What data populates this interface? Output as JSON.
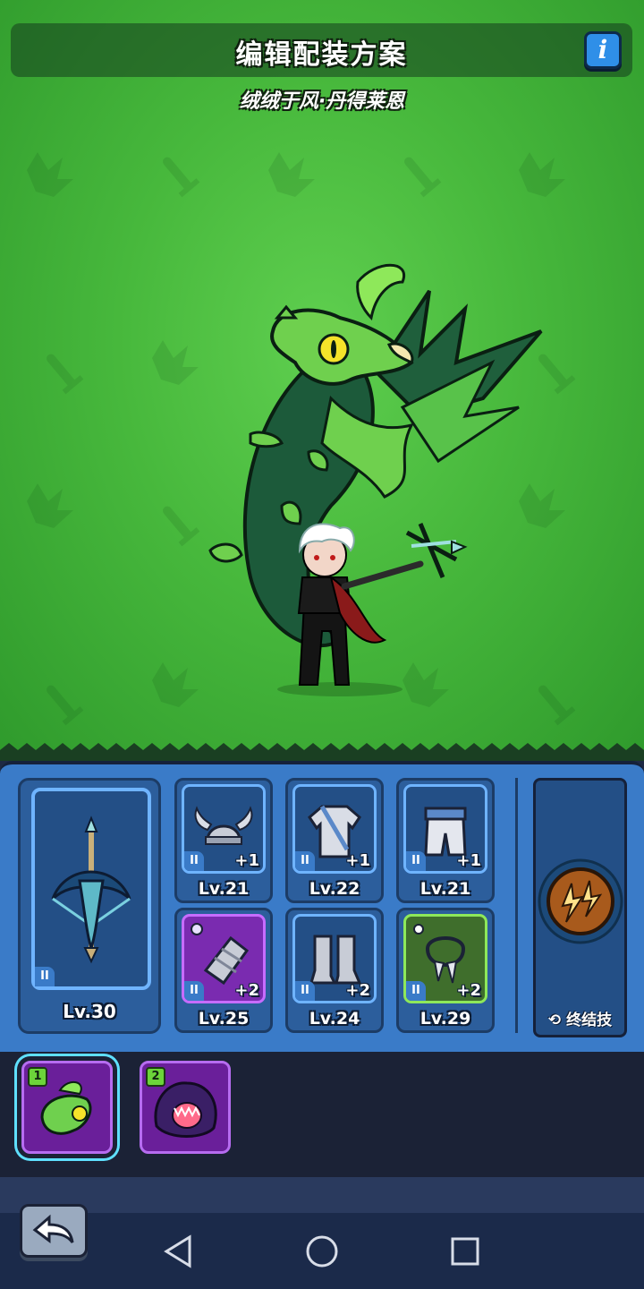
{
  "header": {
    "title": "编辑配装方案",
    "subtitle": "绒绒于风·丹得莱恩",
    "info_label": "i"
  },
  "equipment": {
    "weapon": {
      "level": "Lv.30",
      "tier": "II",
      "icon": "crossbow-icon"
    },
    "slots": [
      {
        "icon": "horned-helmet-icon",
        "tier": "II",
        "bonus": "+1",
        "level": "Lv.21",
        "rarity": "blue"
      },
      {
        "icon": "chest-armor-icon",
        "tier": "II",
        "bonus": "+1",
        "level": "Lv.22",
        "rarity": "blue"
      },
      {
        "icon": "leg-armor-icon",
        "tier": "II",
        "bonus": "+1",
        "level": "Lv.21",
        "rarity": "blue"
      },
      {
        "icon": "gauntlet-icon",
        "tier": "II",
        "bonus": "+2",
        "level": "Lv.25",
        "rarity": "purple"
      },
      {
        "icon": "boots-icon",
        "tier": "II",
        "bonus": "+2",
        "level": "Lv.24",
        "rarity": "blue"
      },
      {
        "icon": "fang-necklace-icon",
        "tier": "II",
        "bonus": "+2",
        "level": "Lv.29",
        "rarity": "green"
      }
    ],
    "ultimate": {
      "label": "终结技",
      "icon": "lightning-orb-icon"
    }
  },
  "pets": [
    {
      "number": "1",
      "icon": "green-dragon-pet-icon",
      "selected": true
    },
    {
      "number": "2",
      "icon": "purple-beast-pet-icon",
      "selected": false
    }
  ],
  "colors": {
    "stage_green": "#47b83c",
    "panel_blue": "#3a7bc8",
    "epic_purple": "#7a2bb0",
    "select_cyan": "#5fe0ff"
  }
}
